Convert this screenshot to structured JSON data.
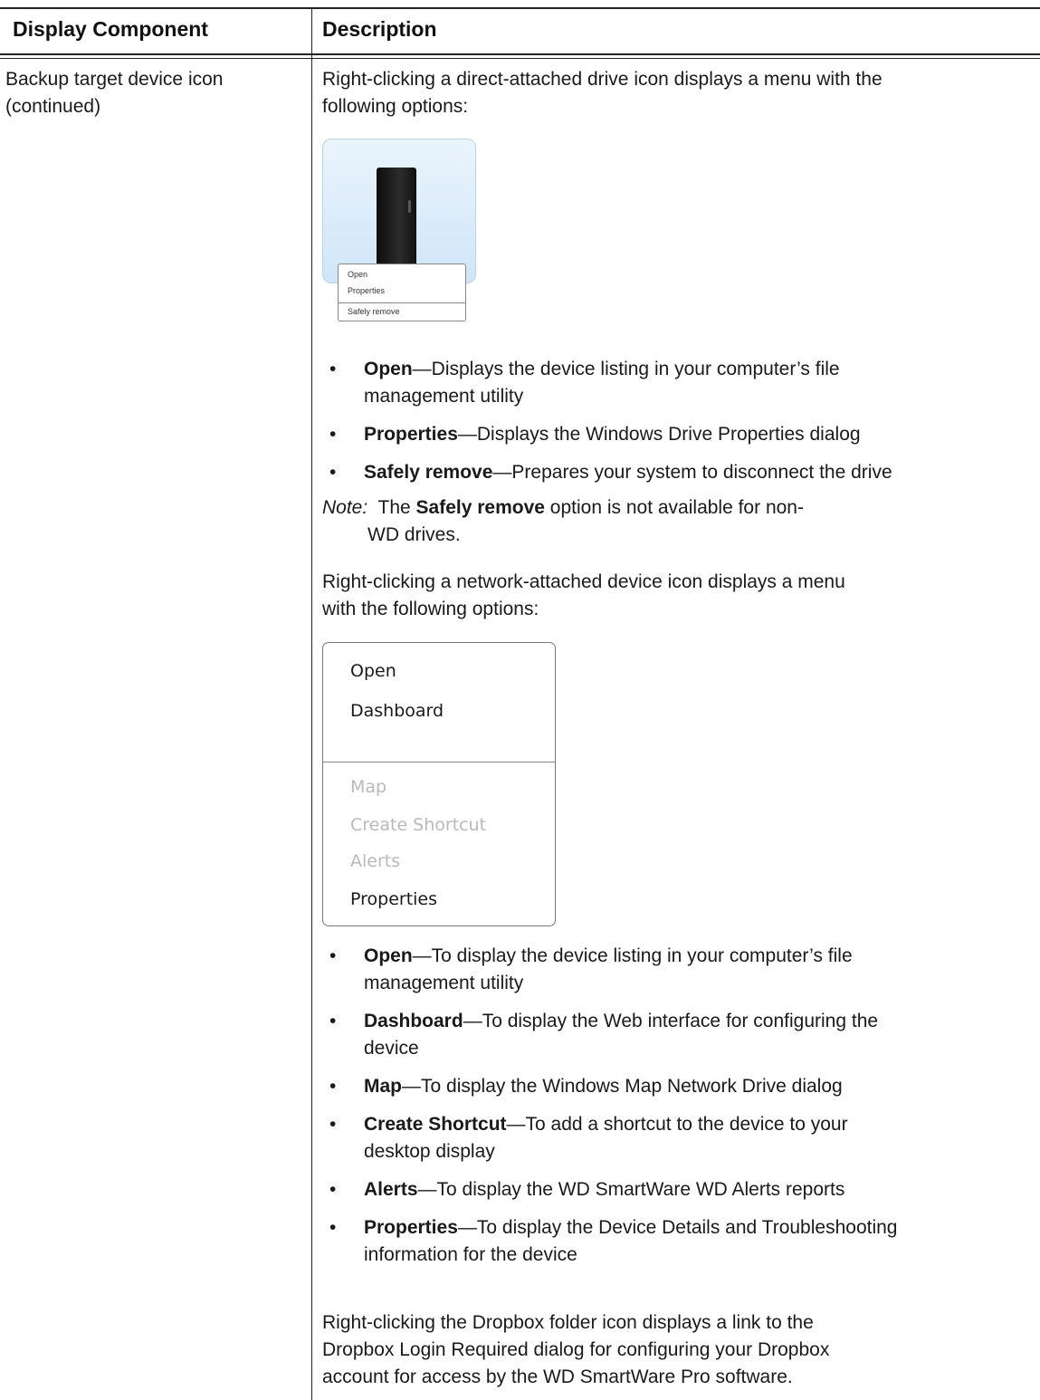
{
  "table": {
    "col1_header": "Display Component",
    "col2_header": "Description"
  },
  "row": {
    "component_line1": "Backup target device icon",
    "component_line2": "(continued)"
  },
  "section1": {
    "intro_line1": "Right-clicking a direct-attached drive icon displays a menu with the",
    "intro_line2": "following options:",
    "menu_items": [
      "Open",
      "Properties",
      "Safely remove"
    ],
    "bullets": [
      {
        "term": "Open",
        "dash": "—",
        "text": "Displays the device listing in your computer’s file",
        "text2": "management utility"
      },
      {
        "term": "Properties",
        "dash": "—",
        "text": "Displays the Windows Drive Properties dialog"
      },
      {
        "term": "Safely remove",
        "dash": "—",
        "text": "Prepares your system to disconnect the drive"
      }
    ],
    "note_label": "Note:",
    "note_pre": "The",
    "note_term": "Safely remove",
    "note_post": "option is not available for non-",
    "note_line2": "WD drives."
  },
  "section2": {
    "intro_line1": "Right-clicking a network-attached device icon displays a menu",
    "intro_line2": "with the following options:",
    "menu_items": [
      {
        "label": "Open",
        "enabled": true
      },
      {
        "label": "Dashboard",
        "enabled": true
      },
      {
        "label": "Map",
        "enabled": false
      },
      {
        "label": "Create Shortcut",
        "enabled": false
      },
      {
        "label": "Alerts",
        "enabled": false
      },
      {
        "label": "Properties",
        "enabled": true
      }
    ],
    "bullets": [
      {
        "term": "Open",
        "dash": "—",
        "text": "To display the device listing in your computer’s file",
        "text2": "management utility"
      },
      {
        "term": "Dashboard",
        "dash": "—",
        "text": "To display the Web interface for configuring the",
        "text2": "device"
      },
      {
        "term": "Map",
        "dash": "—",
        "text": "To display the Windows Map Network Drive dialog"
      },
      {
        "term": "Create Shortcut",
        "dash": "—",
        "text": "To add a shortcut to the device to your",
        "text2": "desktop display"
      },
      {
        "term": "Alerts",
        "dash": "—",
        "text": "To display the WD SmartWare WD Alerts reports"
      },
      {
        "term": "Properties",
        "dash": "—",
        "text": "To display the Device Details and Troubleshooting",
        "text2": "information for the device"
      }
    ]
  },
  "section3": {
    "line1": "Right-clicking the Dropbox folder icon displays a link to the",
    "line2": "Dropbox Login Required dialog for configuring your Dropbox",
    "line3": "account for access by the WD SmartWare Pro software."
  }
}
